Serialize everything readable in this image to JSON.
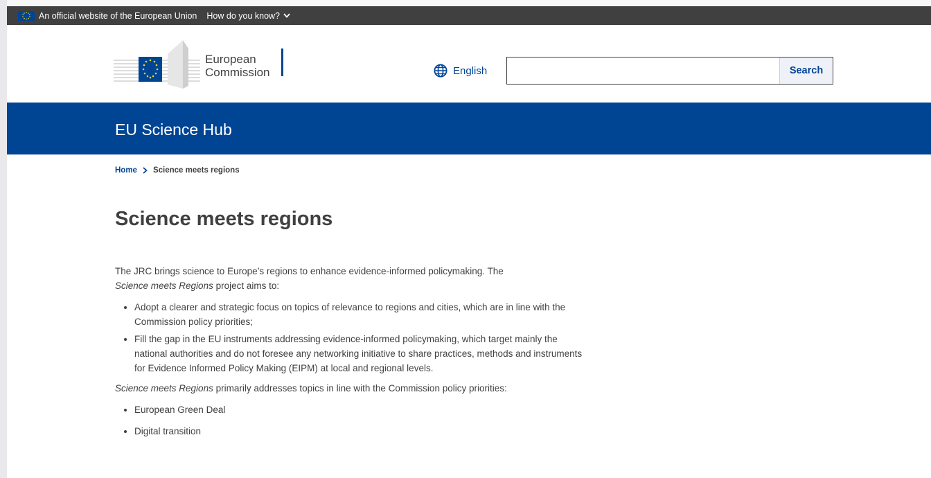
{
  "banner": {
    "official_text": "An official website of the European Union",
    "how_know_text": "How do you know?"
  },
  "header": {
    "logo_line1": "European",
    "logo_line2": "Commission",
    "language": "English",
    "search_placeholder": "",
    "search_button": "Search"
  },
  "site": {
    "title": "EU Science Hub"
  },
  "breadcrumb": {
    "home": "Home",
    "current": "Science meets regions"
  },
  "page": {
    "title": "Science meets regions",
    "intro_1": "The JRC brings science to Europe’s regions to enhance evidence-informed policymaking. The",
    "intro_2_em": "Science meets Regions",
    "intro_2_rest": " project aims to:",
    "aims": [
      "Adopt a clearer and strategic focus on topics of relevance to regions and cities, which are in line with the Commission policy priorities;",
      "Fill the gap in the EU instruments addressing evidence-informed policymaking, which target mainly the national authorities and do not foresee any networking initiative to share practices, methods and instruments for Evidence Informed Policy Making (EIPM) at local and regional levels."
    ],
    "outro_em": "Science meets Regions",
    "outro_rest": " primarily addresses topics in line with the Commission policy priorities:",
    "priorities": [
      "European Green Deal",
      "Digital transition"
    ]
  },
  "colors": {
    "eu_blue": "#004494",
    "banner_grey": "#404040",
    "text": "#404040"
  },
  "icons": {
    "flag": "eu-flag-icon",
    "chevron": "chevron-down-icon",
    "globe": "globe-icon",
    "breadcrumb_separator": "chevron-right-icon"
  }
}
